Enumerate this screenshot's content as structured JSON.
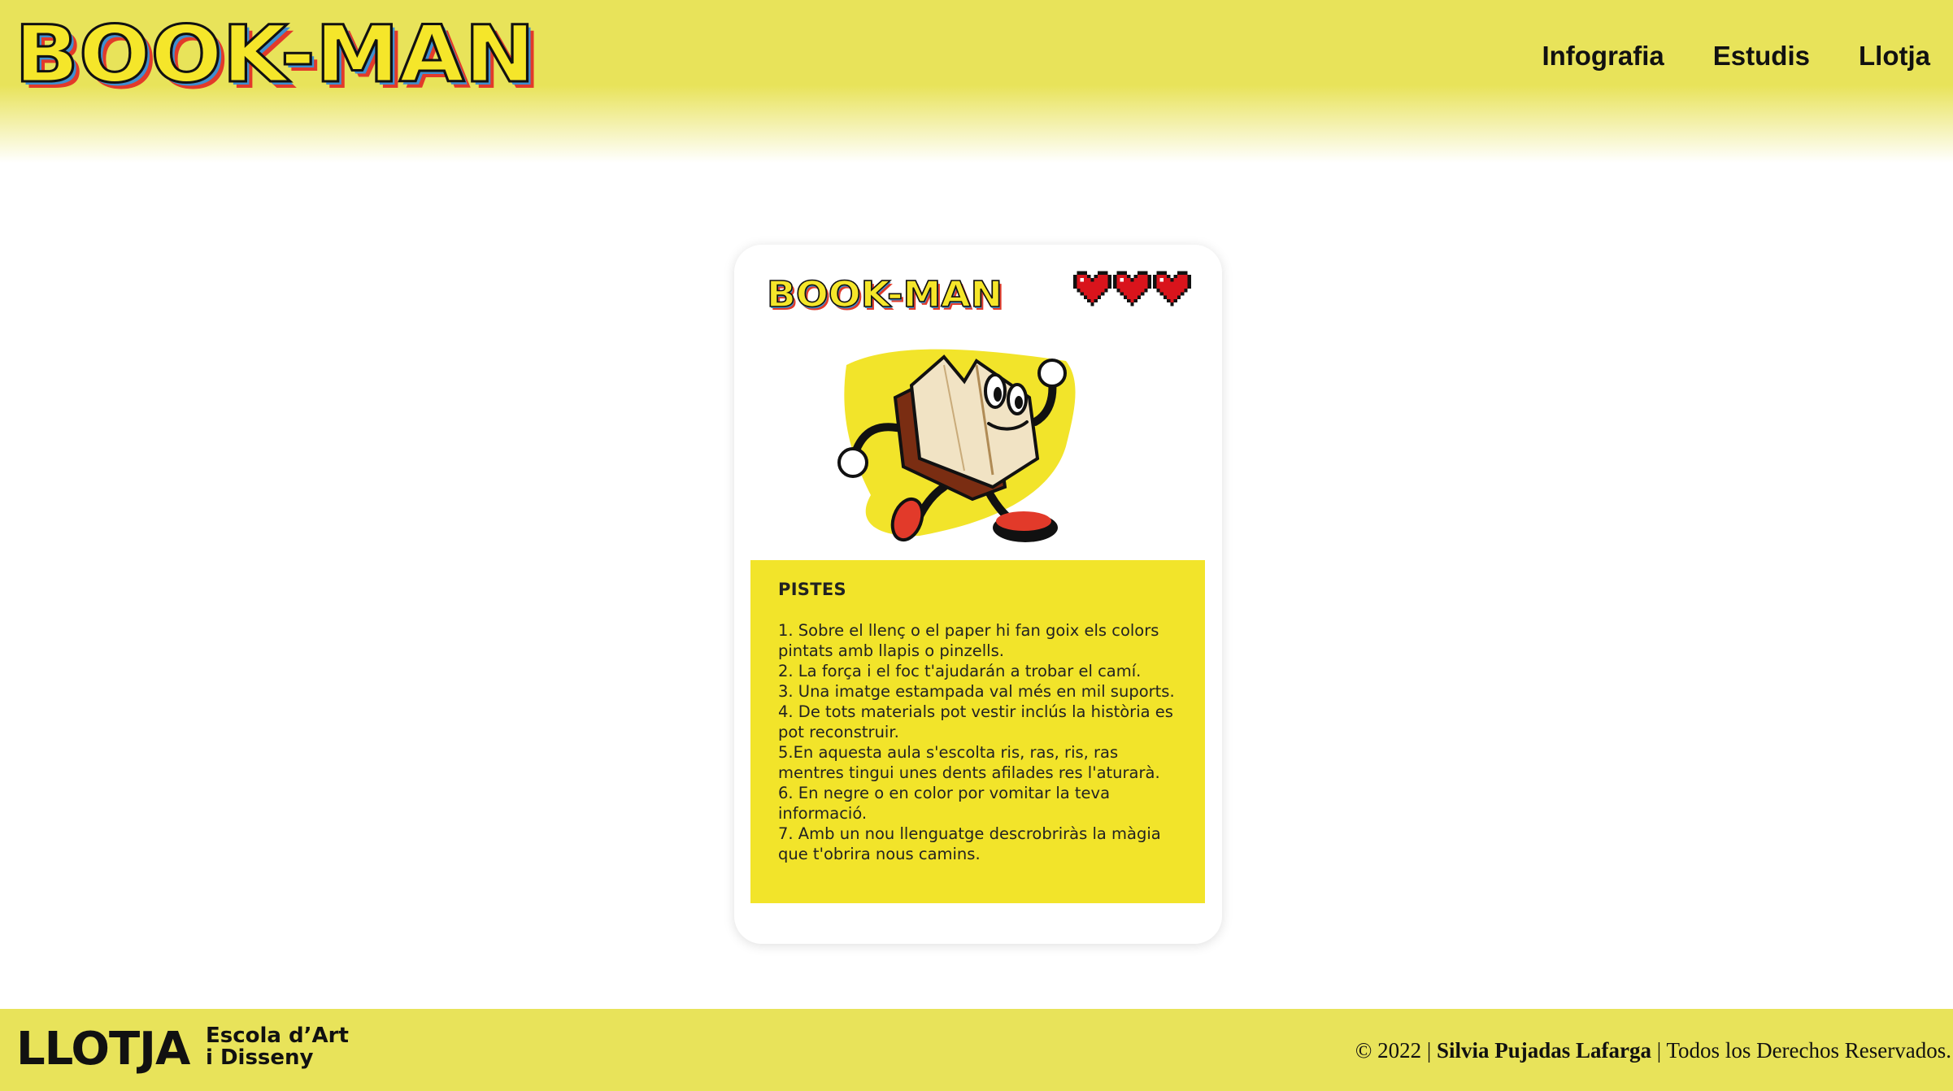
{
  "header": {
    "logo_text": "BOOK-MAN",
    "nav": [
      {
        "label": "Infografia"
      },
      {
        "label": "Estudis"
      },
      {
        "label": "Llotja"
      }
    ]
  },
  "card": {
    "logo_text": "BOOK-MAN",
    "lives": 3,
    "mascot": "running-book-character",
    "clues": {
      "title": "PISTES",
      "items": [
        "1. Sobre el llenç o el paper hi fan goix els colors pintats amb llapis o pinzells.",
        "2. La força i el foc t'ajudarán a trobar el camí.",
        "3. Una imatge estampada val més en mil suports.",
        "4. De tots materials pot vestir inclús la història es pot reconstruir.",
        "5.En aquesta aula s'escolta ris, ras, ris, ras mentres tingui unes dents afilades res l'aturarà.",
        "6. En negre o en color por vomitar la teva informació.",
        "7. Amb un nou llenguatge descrobriràs la màgia que t'obrira nous camins."
      ]
    }
  },
  "footer": {
    "school_logo": "LLOTJA",
    "school_line1": "Escola d’Art",
    "school_line2": "i Disseny",
    "copyright_prefix": "© 2022 |",
    "author": "Silvia Pujadas Lafarga",
    "copyright_suffix": "| Todos los Derechos Reservados."
  },
  "colors": {
    "brand_yellow": "#e8e35a",
    "card_yellow": "#f2e42a",
    "logo_fill": "#f5e62a",
    "logo_red": "#e23a2a",
    "logo_blue": "#3f8fd0",
    "heart_red": "#d9141c"
  }
}
